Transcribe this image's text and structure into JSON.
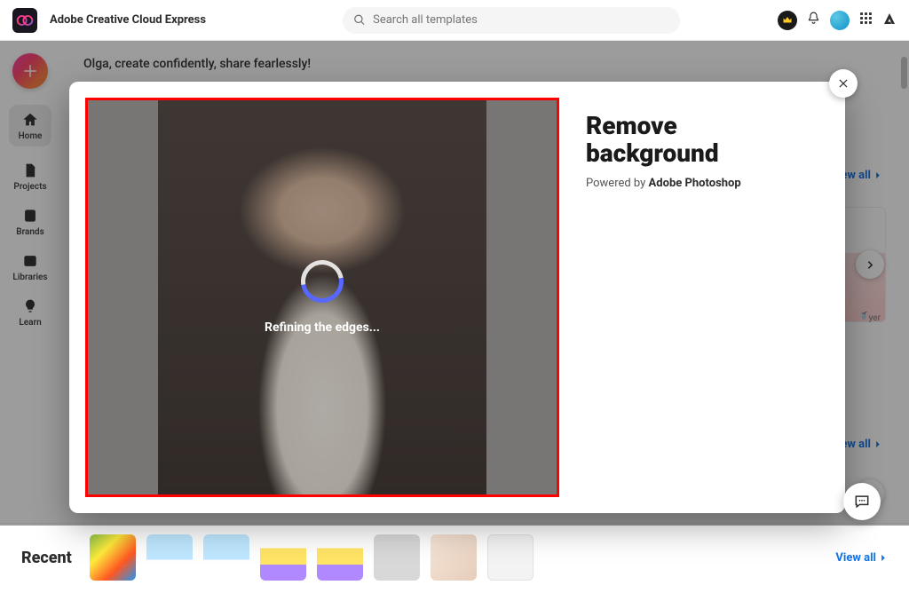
{
  "app": {
    "name": "Adobe Creative Cloud Express"
  },
  "search": {
    "placeholder": "Search all templates"
  },
  "rail": {
    "home": "Home",
    "projects": "Projects",
    "brands": "Brands",
    "libraries": "Libraries",
    "learn": "Learn"
  },
  "greeting": "Olga, create confidently, share fearlessly!",
  "links": {
    "view_all_1": "View all",
    "view_all_2": "View all",
    "recent_view_all": "View all"
  },
  "peek_caption": "yer",
  "recent": {
    "title": "Recent"
  },
  "modal": {
    "title_line1": "Remove",
    "title_line2": "background",
    "sub_prefix": "Powered by ",
    "sub_brand": "Adobe Photoshop",
    "status": "Refining the edges..."
  }
}
